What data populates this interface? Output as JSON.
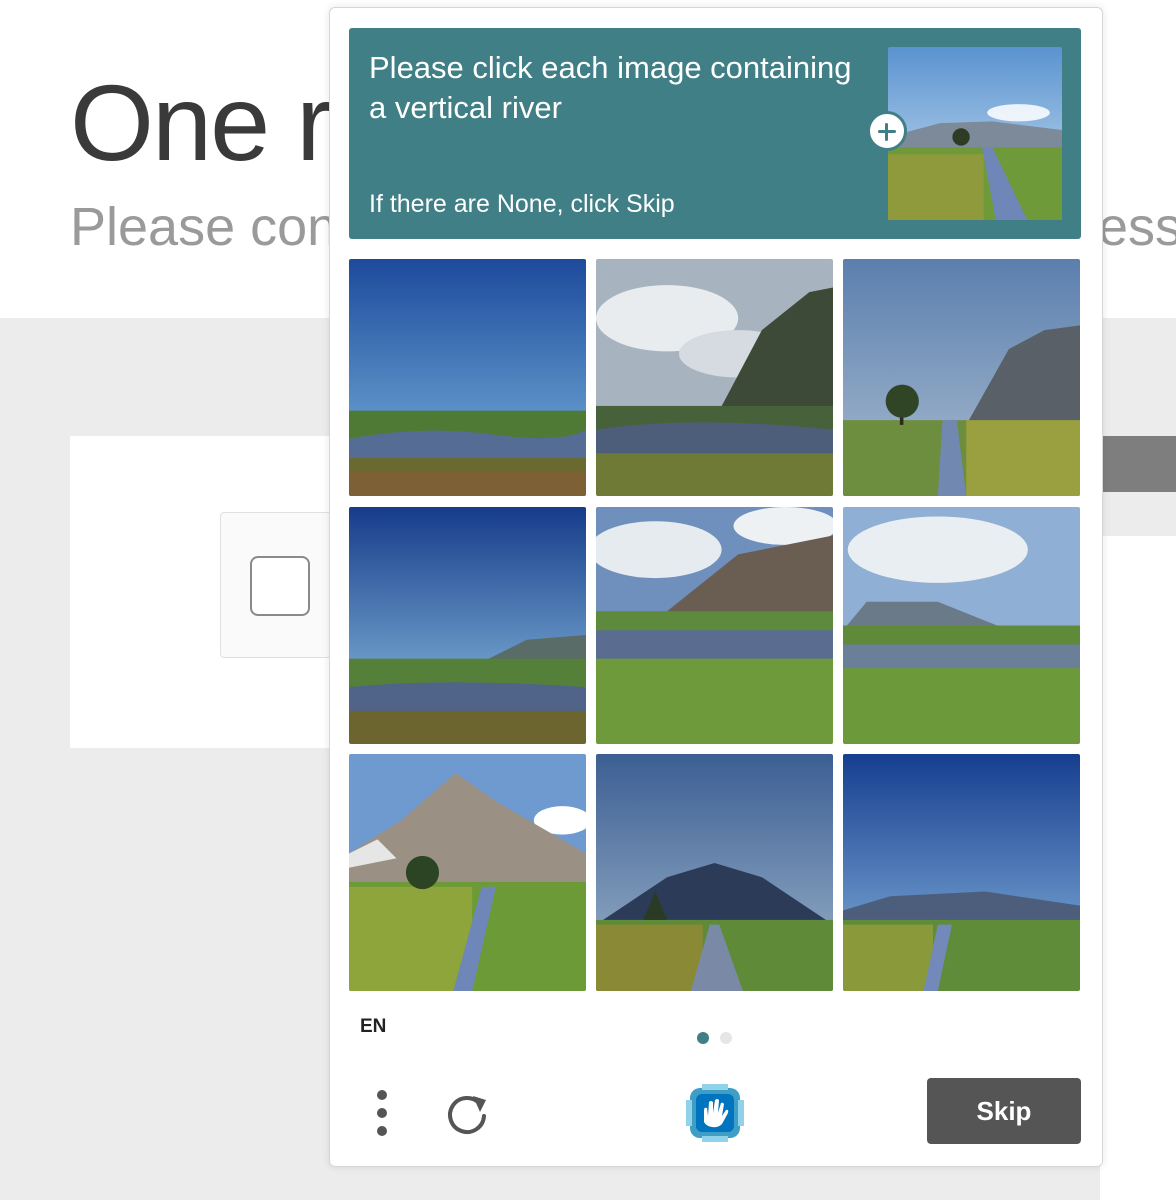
{
  "background_page": {
    "title_visible": "One r",
    "subtitle_left_visible": "Please con",
    "subtitle_right_visible": "ess"
  },
  "captcha": {
    "prompt": "Please click each image containing a vertical river",
    "hint": "If there are None, click Skip",
    "example_image": "vertical-river-example",
    "tiles": [
      {
        "scene": "flat-plain-horizontal-river"
      },
      {
        "scene": "cliff-cloudy-horizontal-river"
      },
      {
        "scene": "cliff-tree-vertical-river"
      },
      {
        "scene": "low-hill-horizontal-river"
      },
      {
        "scene": "ridge-clouds-horizontal-river"
      },
      {
        "scene": "distant-mountain-horizontal-river"
      },
      {
        "scene": "snowy-peak-vertical-river"
      },
      {
        "scene": "dark-mountain-vertical-river"
      },
      {
        "scene": "distant-hills-vertical-river"
      }
    ],
    "language": "EN",
    "pagination": {
      "current": 1,
      "total": 2
    },
    "colors": {
      "accent": "#3f7f85",
      "skip_button": "#555555"
    },
    "icons": [
      "plus-icon",
      "more-vertical-icon",
      "refresh-icon",
      "hcaptcha-logo-icon"
    ],
    "skip_label": "Skip"
  }
}
